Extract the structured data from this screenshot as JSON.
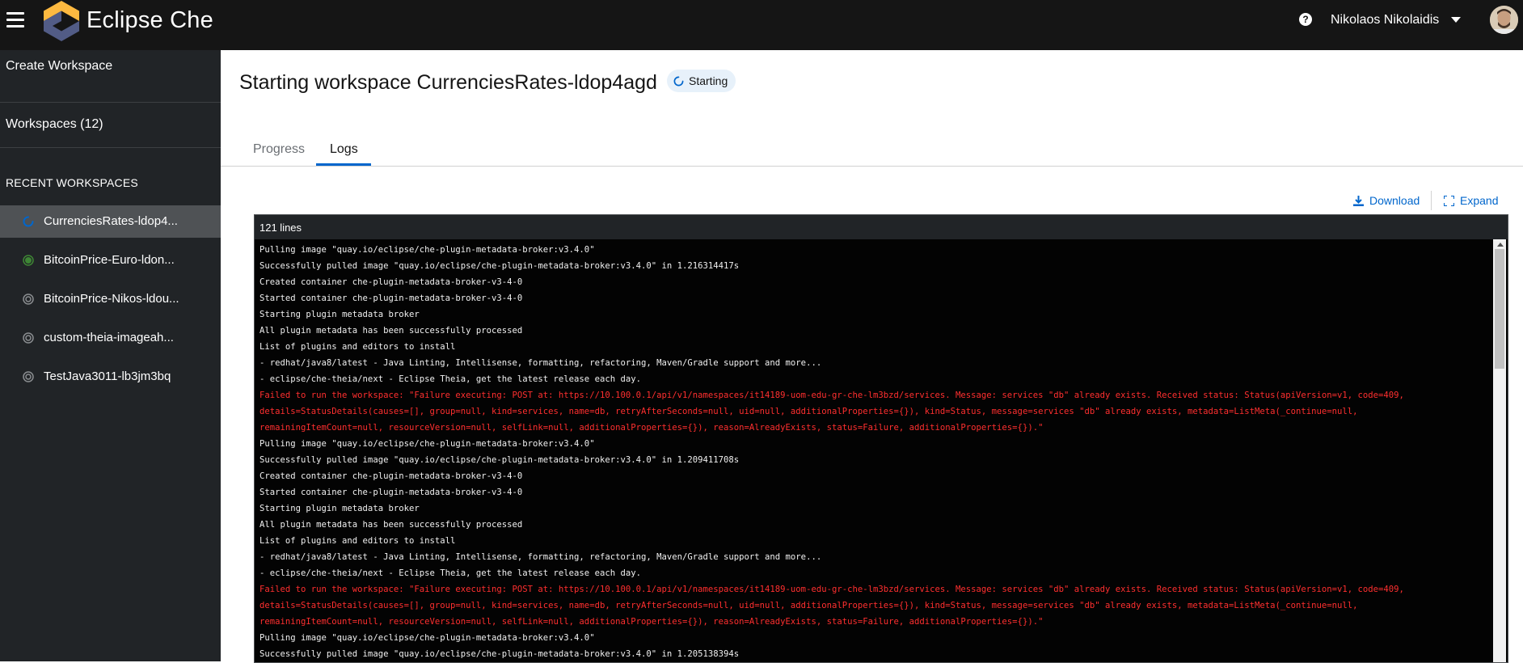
{
  "header": {
    "brand": "Eclipse Che",
    "help_symbol": "?",
    "user_name": "Nikolaos Nikolaidis",
    "icons": [
      "hamburger-menu-icon",
      "eclipse-che-logo",
      "help-icon",
      "chevron-down-icon",
      "avatar"
    ]
  },
  "sidebar": {
    "create_workspace": "Create Workspace",
    "workspaces": "Workspaces (12)",
    "recent_title": "RECENT WORKSPACES",
    "recent": [
      {
        "label": "CurrenciesRates-ldop4...",
        "status": "starting",
        "status_icon": "spinner-icon"
      },
      {
        "label": "BitcoinPrice-Euro-ldon...",
        "status": "running",
        "status_icon": "running-status-icon"
      },
      {
        "label": "BitcoinPrice-Nikos-ldou...",
        "status": "stopped",
        "status_icon": "stopped-status-icon"
      },
      {
        "label": "custom-theia-imageah...",
        "status": "stopped",
        "status_icon": "stopped-status-icon"
      },
      {
        "label": "TestJava3011-lb3jm3bq",
        "status": "stopped",
        "status_icon": "stopped-status-icon"
      }
    ]
  },
  "main": {
    "title": "Starting workspace CurrenciesRates-ldop4agd",
    "status": "Starting",
    "tabs": [
      {
        "label": "Progress",
        "active": false
      },
      {
        "label": "Logs",
        "active": true
      }
    ],
    "actions": {
      "download": "Download",
      "expand": "Expand"
    }
  },
  "logs": {
    "count_label": "121 lines",
    "lines": [
      {
        "text": "Pulling image \"quay.io/eclipse/che-plugin-metadata-broker:v3.4.0\"",
        "error": false
      },
      {
        "text": "Successfully pulled image \"quay.io/eclipse/che-plugin-metadata-broker:v3.4.0\" in 1.216314417s",
        "error": false
      },
      {
        "text": "Created container che-plugin-metadata-broker-v3-4-0",
        "error": false
      },
      {
        "text": "Started container che-plugin-metadata-broker-v3-4-0",
        "error": false
      },
      {
        "text": "Starting plugin metadata broker",
        "error": false
      },
      {
        "text": "All plugin metadata has been successfully processed",
        "error": false
      },
      {
        "text": "List of plugins and editors to install",
        "error": false
      },
      {
        "text": "- redhat/java8/latest - Java Linting, Intellisense, formatting, refactoring, Maven/Gradle support and more...",
        "error": false
      },
      {
        "text": "- eclipse/che-theia/next - Eclipse Theia, get the latest release each day.",
        "error": false
      },
      {
        "text": "Failed to run the workspace: \"Failure executing: POST at: https://10.100.0.1/api/v1/namespaces/it14189-uom-edu-gr-che-lm3bzd/services. Message: services \"db\" already exists. Received status: Status(apiVersion=v1, code=409,",
        "error": true
      },
      {
        "text": "details=StatusDetails(causes=[], group=null, kind=services, name=db, retryAfterSeconds=null, uid=null, additionalProperties={}), kind=Status, message=services \"db\" already exists, metadata=ListMeta(_continue=null,",
        "error": true
      },
      {
        "text": "remainingItemCount=null, resourceVersion=null, selfLink=null, additionalProperties={}), reason=AlreadyExists, status=Failure, additionalProperties={}).\"",
        "error": true
      },
      {
        "text": "Pulling image \"quay.io/eclipse/che-plugin-metadata-broker:v3.4.0\"",
        "error": false
      },
      {
        "text": "Successfully pulled image \"quay.io/eclipse/che-plugin-metadata-broker:v3.4.0\" in 1.209411708s",
        "error": false
      },
      {
        "text": "Created container che-plugin-metadata-broker-v3-4-0",
        "error": false
      },
      {
        "text": "Started container che-plugin-metadata-broker-v3-4-0",
        "error": false
      },
      {
        "text": "Starting plugin metadata broker",
        "error": false
      },
      {
        "text": "All plugin metadata has been successfully processed",
        "error": false
      },
      {
        "text": "List of plugins and editors to install",
        "error": false
      },
      {
        "text": "- redhat/java8/latest - Java Linting, Intellisense, formatting, refactoring, Maven/Gradle support and more...",
        "error": false
      },
      {
        "text": "- eclipse/che-theia/next - Eclipse Theia, get the latest release each day.",
        "error": false
      },
      {
        "text": "Failed to run the workspace: \"Failure executing: POST at: https://10.100.0.1/api/v1/namespaces/it14189-uom-edu-gr-che-lm3bzd/services. Message: services \"db\" already exists. Received status: Status(apiVersion=v1, code=409,",
        "error": true
      },
      {
        "text": "details=StatusDetails(causes=[], group=null, kind=services, name=db, retryAfterSeconds=null, uid=null, additionalProperties={}), kind=Status, message=services \"db\" already exists, metadata=ListMeta(_continue=null,",
        "error": true
      },
      {
        "text": "remainingItemCount=null, resourceVersion=null, selfLink=null, additionalProperties={}), reason=AlreadyExists, status=Failure, additionalProperties={}).\"",
        "error": true
      },
      {
        "text": "Pulling image \"quay.io/eclipse/che-plugin-metadata-broker:v3.4.0\"",
        "error": false
      },
      {
        "text": "Successfully pulled image \"quay.io/eclipse/che-plugin-metadata-broker:v3.4.0\" in 1.205138394s",
        "error": false
      }
    ]
  },
  "colors": {
    "header_bg": "#151515",
    "sidebar_bg": "#212427",
    "sidebar_active": "#4f5255",
    "accent": "#0066cc",
    "log_bg": "#030303",
    "log_error": "#ff2f2f",
    "running": "#3e8635",
    "starting_spinner": "#0066cc"
  }
}
